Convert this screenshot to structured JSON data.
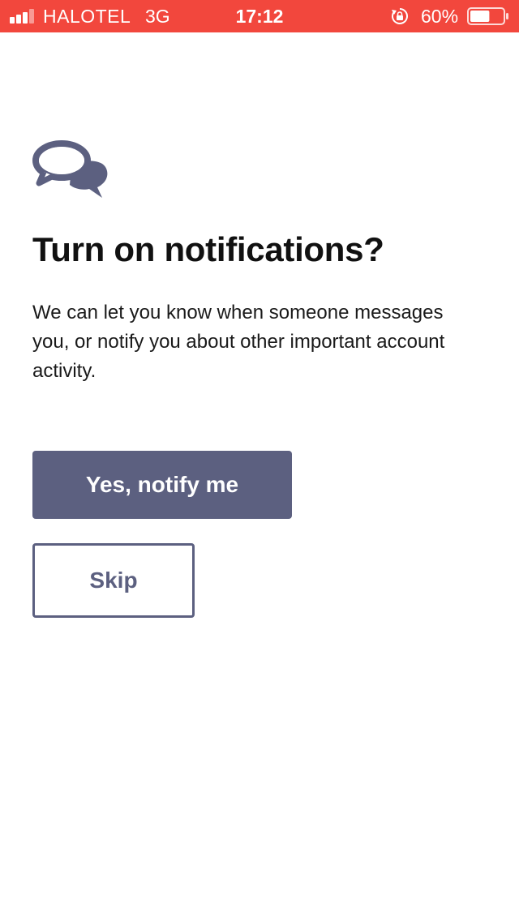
{
  "status_bar": {
    "carrier": "HALOTEL",
    "network": "3G",
    "time": "17:12",
    "battery_percent": "60%",
    "battery_level": 0.6,
    "background_color": "#f2473d",
    "icons": [
      "signal-icon",
      "orientation-lock-icon",
      "battery-icon"
    ]
  },
  "main": {
    "icon": "chat-bubbles-icon",
    "title": "Turn on notifications?",
    "description": "We can let you know when someone messages you, or notify you about other important account activity.",
    "primary_button": "Yes, notify me",
    "secondary_button": "Skip"
  },
  "colors": {
    "accent": "#5c6080",
    "text": "#111111",
    "background": "#ffffff"
  }
}
